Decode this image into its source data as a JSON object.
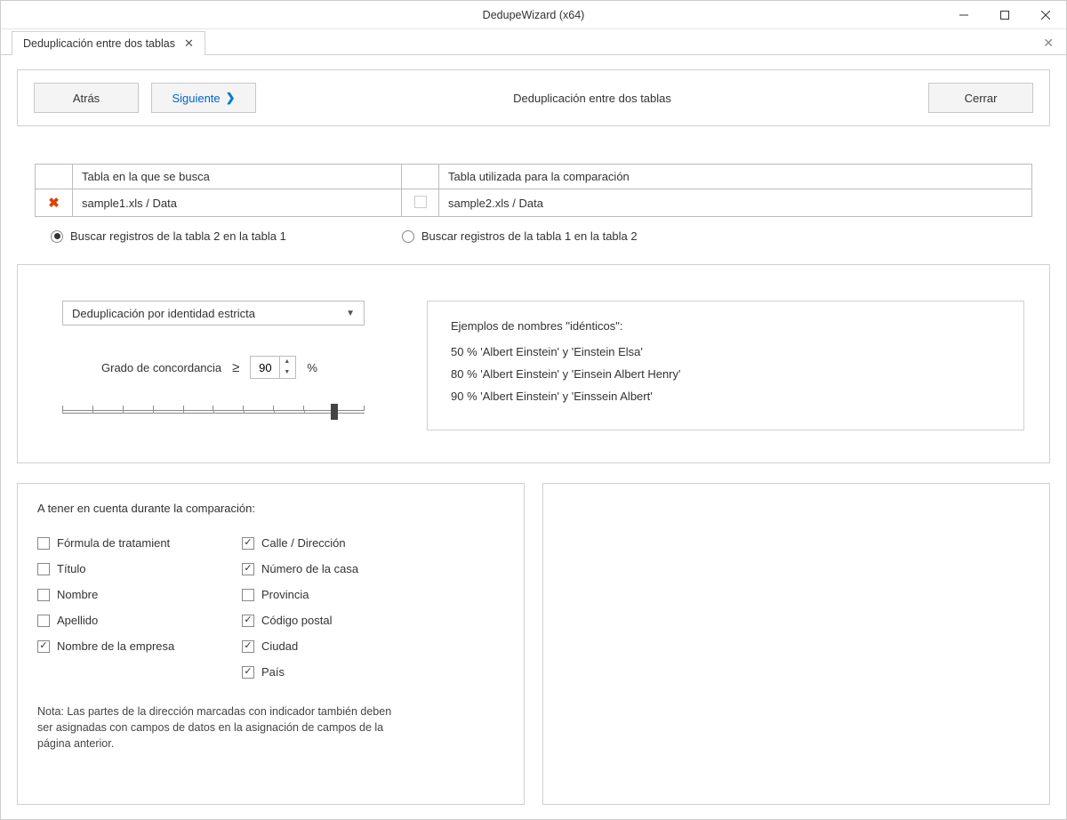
{
  "window": {
    "title": "DedupeWizard  (x64)"
  },
  "tab": {
    "label": "Deduplicación entre dos  tablas"
  },
  "toolbar": {
    "back": "Atrás",
    "next": "Siguiente",
    "title": "Deduplicación entre dos  tablas",
    "close": "Cerrar"
  },
  "tables": {
    "search_header": "Tabla en la que se busca",
    "compare_header": "Tabla utilizada para la comparación",
    "search_value": "sample1.xls / Data",
    "compare_value": "sample2.xls / Data"
  },
  "radios": {
    "opt1": "Buscar registros de la tabla 2 en la tabla 1",
    "opt2": "Buscar registros de la tabla 1 en la tabla 2"
  },
  "dedup": {
    "dropdown": "Deduplicación por identidad estricta",
    "concord_label": "Grado de concordancia",
    "geq": "≥",
    "value": "90",
    "pct": "%"
  },
  "examples": {
    "title": "Ejemplos de nombres \"idénticos\":",
    "r1": "50 %   'Albert Einstein' y 'Einstein Elsa'",
    "r2": "80 %   'Albert Einstein' y 'Einsein Albert Henry'",
    "r3": "90 %   'Albert Einstein' y 'Einssein Albert'"
  },
  "compare": {
    "title": "A tener en cuenta durante la comparación:",
    "col1": [
      {
        "label": "Fórmula de tratamient",
        "checked": false
      },
      {
        "label": "Título",
        "checked": false
      },
      {
        "label": "Nombre",
        "checked": false
      },
      {
        "label": "Apellido",
        "checked": false
      },
      {
        "label": "Nombre de la empresa",
        "checked": true
      }
    ],
    "col2": [
      {
        "label": "Calle / Dirección",
        "checked": true
      },
      {
        "label": "Número de la casa",
        "checked": true
      },
      {
        "label": "Provincia",
        "checked": false
      },
      {
        "label": "Código postal",
        "checked": true
      },
      {
        "label": "Ciudad",
        "checked": true
      },
      {
        "label": "País",
        "checked": true
      }
    ],
    "note": "Nota: Las partes de la dirección marcadas con indicador también deben ser asignadas con campos de datos en la asignación de campos de la página anterior."
  }
}
